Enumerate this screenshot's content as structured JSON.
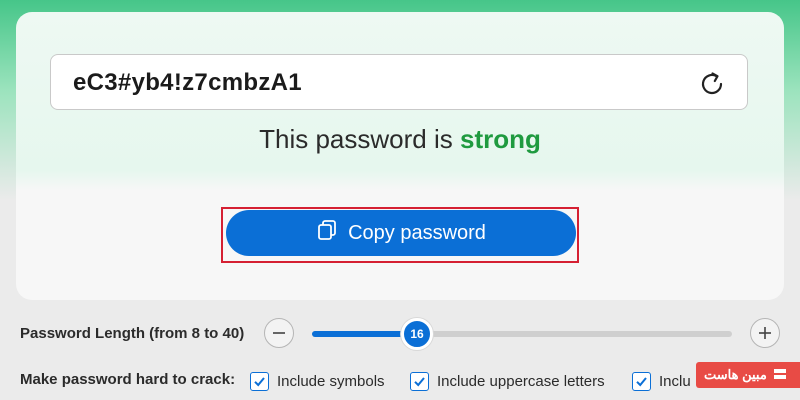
{
  "generator": {
    "password_value": "eC3#yb4!z7cmbzA1",
    "refresh_icon": "refresh-icon",
    "strength_prefix": "This password is",
    "strength_level": "strong",
    "strength_color": "#1f9a3f",
    "copy_button_label": "Copy password",
    "copy_icon": "copy-icon",
    "accent_color": "#0b6fd6",
    "highlight_color": "#d52032"
  },
  "length": {
    "label": "Password Length (from 8 to 40)",
    "min": 8,
    "max": 40,
    "value": 16,
    "value_text": "16",
    "decrease_icon": "minus-icon",
    "increase_icon": "plus-icon"
  },
  "options": {
    "label": "Make password hard to crack:",
    "items": [
      {
        "label": "Include symbols",
        "checked": true
      },
      {
        "label": "Include uppercase letters",
        "checked": true
      },
      {
        "label": "Inclu",
        "checked": true
      }
    ]
  },
  "watermark": {
    "text": "مبین هاست"
  }
}
